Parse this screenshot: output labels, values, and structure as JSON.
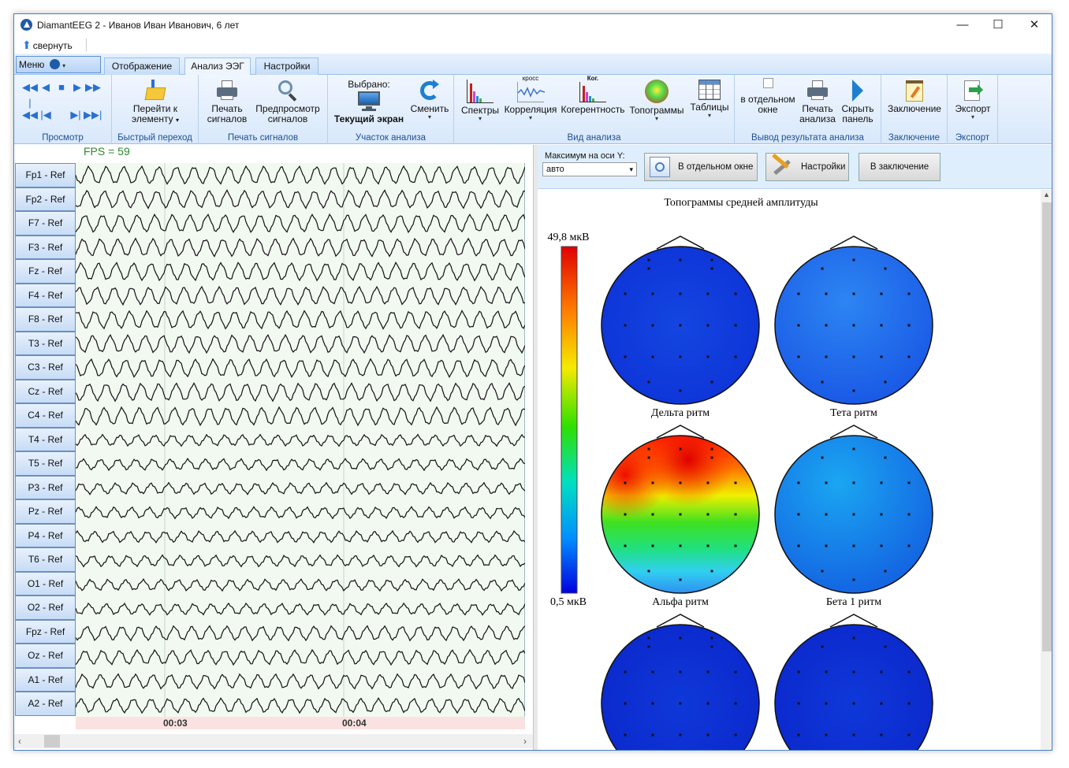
{
  "window": {
    "title": "DiamantEEG 2 - Иванов  Иван Иванович, 6 лет",
    "minimize": "—",
    "maximize": "☐",
    "close": "✕"
  },
  "qat": {
    "collapse_label": "свернуть"
  },
  "menu": {
    "label": "Меню"
  },
  "tabs": [
    {
      "label": "Отображение"
    },
    {
      "label": "Анализ ЭЭГ"
    },
    {
      "label": "Настройки"
    }
  ],
  "ribbon": {
    "groups": {
      "view": "Просмотр",
      "quick": "Быстрый переход",
      "print": "Печать сигналов",
      "section": "Участок анализа",
      "analysis": "Вид анализа",
      "output": "Вывод результата анализа",
      "conclusion": "Заключение",
      "export": "Экспорт"
    },
    "goto": [
      "Перейти к",
      "элементу"
    ],
    "print_signals": [
      "Печать",
      "сигналов"
    ],
    "preview_signals": [
      "Предпросмотр",
      "сигналов"
    ],
    "selected_label": "Выбрано:",
    "current_screen": "Текущий экран",
    "change": "Сменить",
    "spectra": "Спектры",
    "correlation": "Корреляция",
    "cross_tag": "кросс",
    "coherence": "Когерентность",
    "coh_tag": "Ког.",
    "topograms": "Топограммы",
    "tables": "Таблицы",
    "separate_window": [
      "в отдельном",
      "окне"
    ],
    "print_analysis": [
      "Печать",
      "анализа"
    ],
    "hide_panel": [
      "Скрыть",
      "панель"
    ],
    "conclusion_btn": "Заключение",
    "export_btn": "Экспорт"
  },
  "eeg": {
    "fps": "FPS = 59",
    "channels": [
      "Fp1 - Ref",
      "Fp2 - Ref",
      "F7 - Ref",
      "F3 - Ref",
      "Fz - Ref",
      "F4 - Ref",
      "F8 - Ref",
      "T3 - Ref",
      "C3 - Ref",
      "Cz - Ref",
      "C4 - Ref",
      "T4 - Ref",
      "T5 - Ref",
      "P3 - Ref",
      "Pz - Ref",
      "P4 - Ref",
      "T6 - Ref",
      "O1 - Ref",
      "O2 - Ref",
      "Fpz - Ref",
      "Oz - Ref",
      "A1 - Ref",
      "A2 - Ref"
    ],
    "times": [
      "00:03",
      "00:04"
    ]
  },
  "right_toolbar": {
    "ymax_label": "Максимум на оси Y:",
    "ymax_value": "авто",
    "separate_btn": "В отдельном окне",
    "settings_btn": "Настройки",
    "to_conclusion_btn": "В заключение"
  },
  "topography": {
    "title": "Топограммы средней амплитуды",
    "scale_max": "49,8 мкВ",
    "scale_min": "0,5 мкВ",
    "maps": [
      {
        "label": "Дельта ритм"
      },
      {
        "label": "Тета ритм"
      },
      {
        "label": "Альфа ритм"
      },
      {
        "label": "Бета 1 ритм"
      }
    ]
  }
}
